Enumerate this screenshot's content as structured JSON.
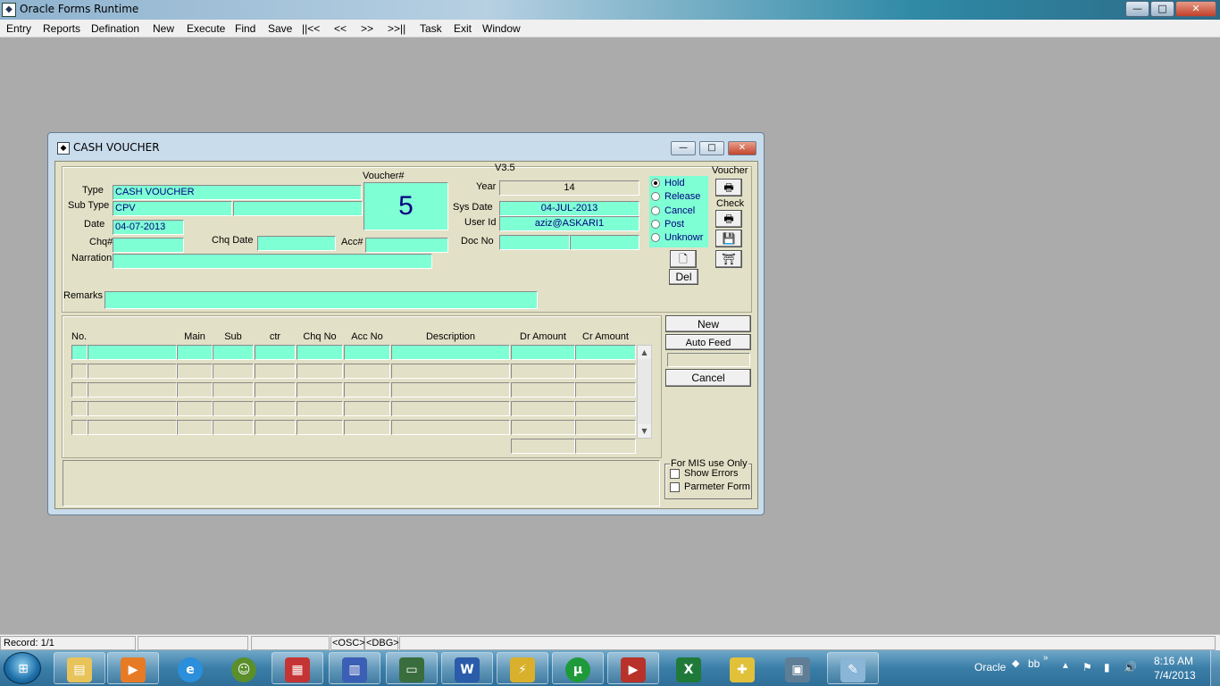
{
  "window": {
    "title": "Oracle Forms Runtime",
    "icon_name": "oracle-forms-icon",
    "minimize_glyph": "—",
    "maximize_glyph": "□",
    "close_glyph": "✕"
  },
  "menu": {
    "items": [
      "Entry",
      "Reports",
      "Defination",
      "New",
      "Execute",
      "Find",
      "Save",
      "||<<",
      "<<",
      ">>",
      ">>||",
      "Task",
      "Exit",
      "Window"
    ]
  },
  "form": {
    "title": "CASH VOUCHER",
    "version": "V3.5",
    "labels": {
      "type": "Type",
      "sub_type": "Sub Type",
      "date": "Date",
      "chq": "Chq#",
      "chq_date": "Chq Date",
      "acc": "Acc#",
      "narration": "Narration",
      "remarks": "Remarks",
      "voucher_no": "Voucher#",
      "year": "Year",
      "sys_date": "Sys Date",
      "user_id": "User Id",
      "doc_no": "Doc No",
      "voucher_group": "Voucher",
      "check_group": "Check"
    },
    "values": {
      "type": "CASH VOUCHER",
      "sub_type": "CPV",
      "sub_type_desc": "",
      "date": "04-07-2013",
      "chq": "",
      "chq_date": "",
      "acc": "",
      "narration": "",
      "remarks": "",
      "voucher_no": "5",
      "year": "14",
      "sys_date": "04-JUL-2013",
      "user_id": "aziz@ASKARI1",
      "doc_no": "",
      "doc_no_2": ""
    },
    "status_options": [
      {
        "label": "Hold",
        "selected": true
      },
      {
        "label": "Release",
        "selected": false
      },
      {
        "label": "Cancel",
        "selected": false
      },
      {
        "label": "Post",
        "selected": false
      },
      {
        "label": "Unknowr",
        "selected": false
      }
    ],
    "buttons": {
      "del": "Del",
      "new": "New",
      "auto_feed": "Auto Feed",
      "cancel": "Cancel"
    },
    "grid": {
      "columns": [
        "No.",
        "Main",
        "Sub",
        "ctr",
        "Chq No",
        "Acc No",
        "Description",
        "Dr Amount",
        "Cr Amount"
      ],
      "row_count": 5
    },
    "mis": {
      "title": "For MIS use Only",
      "show_errors": "Show Errors",
      "parameter_form": "Parmeter Form"
    }
  },
  "statusbar": {
    "record": "Record: 1/1",
    "osc": "<OSC>",
    "dbg": "<DBG>"
  },
  "taskbar": {
    "apps": [
      "explorer-icon",
      "media-player-icon",
      "internet-explorer-icon",
      "frog-app-icon",
      "report-app-icon",
      "report-app-2-icon",
      "monitor-app-icon",
      "word-icon",
      "paint-tool-icon",
      "utorrent-icon",
      "presentation-icon",
      "excel-icon",
      "medical-app-icon",
      "computer-icon",
      "paint-icon"
    ],
    "tray_label_1": "Oracle",
    "tray_label_2": "bb",
    "time": "8:16 AM",
    "date": "7/4/2013"
  }
}
